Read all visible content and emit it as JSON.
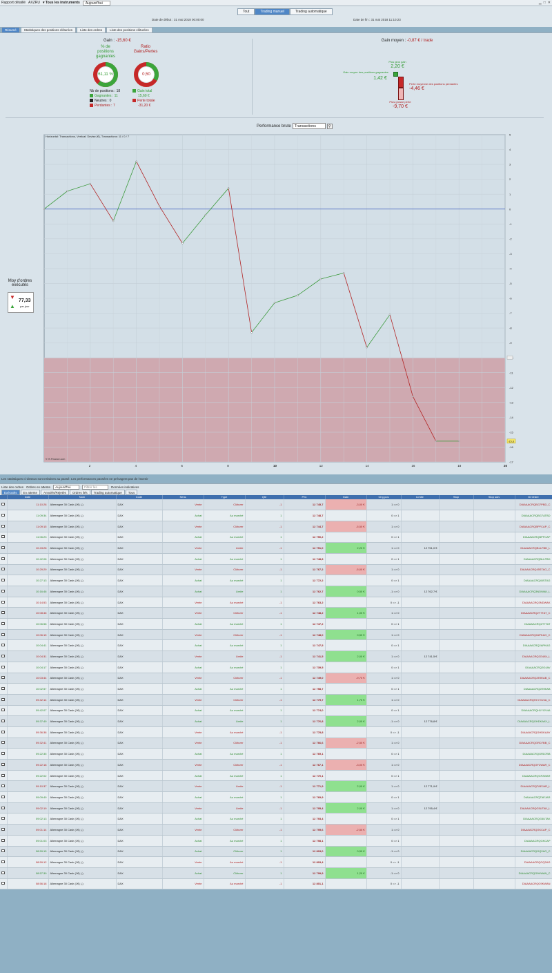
{
  "titlebar": {
    "title": "Rapport détaillé",
    "account": "AXZRU",
    "instruments": "▾ Tous les instruments",
    "period": "Aujourd'hui"
  },
  "segments": [
    "Tout",
    "Trading manuel",
    "Trading automatique"
  ],
  "active_segment": 1,
  "dates": {
    "start": "Date de début : 31 mai 2018 00:00:00",
    "end": "Date de fin : 31 mai 2018 11:10:23"
  },
  "tabs": [
    "Résumé",
    "Statistiques des positions clôturées",
    "Liste des ordres",
    "Liste des positions clôturées"
  ],
  "summary": {
    "gain_label": "Gain : ",
    "gain_value": "-15,60 €",
    "pct_title": "% de\npositions\ngagnantes",
    "pct_value": "61,11 %",
    "pct_fraction": 0.6111,
    "ratio_title": "Ratio\nGains/Pertes",
    "ratio_value": "0,50",
    "ratio_fraction": 0.333,
    "nb_positions": "Nb de positions : 18",
    "gagnantes": "Gagnantes : 11",
    "neutres": "Neutres : 0",
    "perdantes": "Perdantes : 7",
    "gain_total_label": "Gain total",
    "gain_total": "15,60 €",
    "perte_totale_label": "Perte totale",
    "perte_totale": "-31,20 €",
    "gain_moyen_label": "Gain moyen : ",
    "gain_moyen": "-0,87 € / trade",
    "plus_gros_gain_label": "Plus gros gain",
    "plus_gros_gain": "2,20 €",
    "gain_moyen_pos_label": "Gain moyen des positions gagnantes",
    "gain_moyen_pos": "1,42 €",
    "perte_moyenne_label": "Perte moyenne des positions perdantes",
    "perte_moyenne": "-4,46 €",
    "plus_grosse_perte_label": "Plus grosse perte",
    "plus_grosse_perte": "-9,70 €"
  },
  "chart_header": {
    "label": "Performance brute",
    "selector": "Transactions",
    "info": "Horizontal: Transactions, Vertical: Devise (€), Transactions: 11 / 0 / 7",
    "credit": "© IT-Finance.com"
  },
  "moy": {
    "label": "Moy d'ordres exécutés",
    "value": "77,33",
    "unit": "par jour"
  },
  "chart_data": {
    "type": "line",
    "x": [
      0,
      1,
      2,
      3,
      4,
      5,
      6,
      7,
      8,
      9,
      10,
      11,
      12,
      13,
      14,
      15,
      16,
      17,
      18
    ],
    "values": [
      0,
      1.2,
      1.7,
      -0.8,
      3.2,
      0.2,
      -2.3,
      -0.4,
      1.4,
      -8.3,
      -6.3,
      -5.8,
      -4.7,
      -4.3,
      -9.3,
      -7.1,
      -12.6,
      -15.6,
      -15.6
    ],
    "xlim": [
      0,
      20
    ],
    "ylim": [
      -17,
      5
    ],
    "xticks": [
      2,
      4,
      6,
      8,
      10,
      12,
      14,
      16,
      18,
      20
    ],
    "yticks": [
      5,
      4,
      3,
      2,
      1,
      0,
      -1,
      -2,
      -3,
      -4,
      -5,
      -6,
      -7,
      -8,
      -9,
      -10,
      -11,
      -12,
      -13,
      -14,
      -15,
      -16,
      -17
    ],
    "current_value_label": "-15,6",
    "loss_zone_from": -10,
    "up_color": "#3b9a3b",
    "down_color": "#b22222",
    "zero_line_color": "#4060c0",
    "loss_zone_color": "#cfa9b0"
  },
  "disclaimer": "Les statistiques ci-dessus sont relatives au passé. Les performances passées ne présagent pas de l'avenir",
  "orders_bar": {
    "title": "Liste des ordres",
    "mode": "Ordres en attente",
    "period": "Aujourd'hui",
    "filter_placeholder": "Filtrer les ordres",
    "data": "Données indicatives"
  },
  "order_tabs": [
    "Exécutés",
    "En attente",
    "Annulés/Rejetés",
    "Ordres liés",
    "Trading automatique",
    "Tous"
  ],
  "columns": [
    "",
    "Date",
    "Nom",
    "Code",
    "Sens",
    "Type",
    "Qté",
    "Prix",
    "Gain",
    "Chg pos",
    "Limite",
    "Stop",
    "Stop suiv",
    "ID Ordre"
  ],
  "orders": [
    [
      "11:10:28",
      "Allemagne 30 Cash (1€) (-)",
      "DAX",
      "Vente",
      "Clôturer",
      "-1",
      "12 745,7",
      "-3,00 €",
      "1 => 0",
      "",
      "",
      "",
      "DIAAAACRQBG7PBD_C"
    ],
    [
      "11:09:34",
      "Allemagne 30 Cash (1€) (-)",
      "DAX",
      "Achat",
      "Au marché",
      "1",
      "12 748,7",
      "",
      "0 => 1",
      "",
      "",
      "",
      "DIAAAACRQBG7ATBD"
    ],
    [
      "11:09:15",
      "Allemagne 30 Cash (1€) (-)",
      "DAX",
      "Vente",
      "Clôturer",
      "-1",
      "12 744,7",
      "-5,50 €",
      "1 => 0",
      "",
      "",
      "",
      "DIAAAACRQBPFCAP_C"
    ],
    [
      "11:06:23",
      "Allemagne 30 Cash (1€) (-)",
      "DAX",
      "Achat",
      "Au marché",
      "1",
      "12 750,2",
      "",
      "0 => 1",
      "",
      "",
      "",
      "DIAAAACRQBPFCAP"
    ],
    [
      "10:43:28",
      "Allemagne 30 Cash (1€) (-)",
      "DAX",
      "Vente",
      "Limite",
      "-1",
      "12 751,0",
      "2,20 €",
      "1 => 0",
      "12 751,0 €",
      "",
      "",
      "DIAAAACRQBLLFBD_L"
    ],
    [
      "10:42:08",
      "Allemagne 30 Cash (1€) (-)",
      "DAX",
      "Achat",
      "Au marché",
      "1",
      "12 748,8",
      "",
      "0 => 1",
      "",
      "",
      "",
      "DIAAAACRQBLLFBD"
    ],
    [
      "10:29:29",
      "Allemagne 30 Cash (1€) (-)",
      "DAX",
      "Vente",
      "Clôturer",
      "-1",
      "12 767,2",
      "-5,00 €",
      "1 => 0",
      "",
      "",
      "",
      "DIAAAACRQ45STAG_C"
    ],
    [
      "10:27:13",
      "Allemagne 30 Cash (1€) (-)",
      "DAX",
      "Achat",
      "Au marché",
      "1",
      "12 772,2",
      "",
      "0 => 1",
      "",
      "",
      "",
      "DIAAAACRQ45STAG"
    ],
    [
      "10:16:46",
      "Allemagne 30 Cash (1€) (-)",
      "DAX",
      "Achat",
      "Limite",
      "1",
      "12 762,7",
      "0,50 €",
      "-1 => 0",
      "12 762,7 €",
      "",
      "",
      "DIAAAACRQ3NDWAK_L"
    ],
    [
      "10:14:53",
      "Allemagne 30 Cash (1€) (-)",
      "DAX",
      "Vente",
      "Au marché",
      "-1",
      "12 763,2",
      "",
      "0 => -1",
      "",
      "",
      "",
      "DIAAAACRQ3NDWAK"
    ],
    [
      "10:08:46",
      "Allemagne 30 Cash (1€) (-)",
      "DAX",
      "Vente",
      "Clôturer",
      "-1",
      "12 748,2",
      "1,00 €",
      "1 => 0",
      "",
      "",
      "",
      "DIAAAACRQ2T7TAT_C"
    ],
    [
      "10:06:58",
      "Allemagne 30 Cash (1€) (-)",
      "DAX",
      "Achat",
      "Au marché",
      "1",
      "12 747,2",
      "",
      "0 => 1",
      "",
      "",
      "",
      "DIAAAACRQ2T7TAT"
    ],
    [
      "10:06:15",
      "Allemagne 30 Cash (1€) (-)",
      "DAX",
      "Vente",
      "Clôturer",
      "-1",
      "12 748,0",
      "0,50 €",
      "1 => 0",
      "",
      "",
      "",
      "DIAAAACRQ2APKAG_C"
    ],
    [
      "10:04:41",
      "Allemagne 30 Cash (1€) (-)",
      "DAX",
      "Achat",
      "Au marché",
      "1",
      "12 747,5",
      "",
      "0 => 1",
      "",
      "",
      "",
      "DIAAAACRQ2APKAG"
    ],
    [
      "10:04:31",
      "Allemagne 30 Cash (1€) (-)",
      "DAX",
      "Vente",
      "Limite",
      "-1",
      "12 741,5",
      "2,00 €",
      "1 => 0",
      "12 741,5 €",
      "",
      "",
      "DIAAAACRQ2G4AV_L"
    ],
    [
      "10:04:17",
      "Allemagne 30 Cash (1€) (-)",
      "DAX",
      "Achat",
      "Au marché",
      "1",
      "12 739,5",
      "",
      "0 => 1",
      "",
      "",
      "",
      "DIAAAACRQ2G4AV"
    ],
    [
      "10:03:44",
      "Allemagne 30 Cash (1€) (-)",
      "DAX",
      "Vente",
      "Clôturer",
      "-1",
      "12 749,0",
      "-9,70 €",
      "1 => 0",
      "",
      "",
      "",
      "DIAAAACRQ2E9EAB_C"
    ],
    [
      "10:02:57",
      "Allemagne 30 Cash (1€) (-)",
      "DAX",
      "Achat",
      "Au marché",
      "1",
      "12 758,7",
      "",
      "0 => 1",
      "",
      "",
      "",
      "DIAAAACRQ2E9EAB"
    ],
    [
      "09:42:14",
      "Allemagne 30 Cash (1€) (-)",
      "DAX",
      "Vente",
      "Clôturer",
      "-1",
      "12 775,7",
      "1,70 €",
      "1 => 0",
      "",
      "",
      "",
      "DIAAAACRQH1YGV4A_C"
    ],
    [
      "09:42:07",
      "Allemagne 30 Cash (1€) (-)",
      "DAX",
      "Achat",
      "Au marché",
      "1",
      "12 774,0",
      "",
      "0 => 1",
      "",
      "",
      "",
      "DIAAAACRQH1YGV4A"
    ],
    [
      "09:37:49",
      "Allemagne 30 Cash (1€) (-)",
      "DAX",
      "Achat",
      "Limite",
      "1",
      "12 776,8",
      "2,00 €",
      "-1 => 0",
      "12 776,8 €",
      "",
      "",
      "DIAAAACRQGHDKAAY_L"
    ],
    [
      "09:36:38",
      "Allemagne 30 Cash (1€) (-)",
      "DAX",
      "Vente",
      "Au marché",
      "-1",
      "12 778,8",
      "",
      "0 => -1",
      "",
      "",
      "",
      "DIAAAACRQGHDKAAY"
    ],
    [
      "09:32:41",
      "Allemagne 30 Cash (1€) (-)",
      "DAX",
      "Vente",
      "Clôturer",
      "-1",
      "12 766,6",
      "-2,50 €",
      "1 => 0",
      "",
      "",
      "",
      "DIAAAACRQGRD7BB_C"
    ],
    [
      "09:22:35",
      "Allemagne 30 Cash (1€) (-)",
      "DAX",
      "Achat",
      "Au marché",
      "1",
      "12 769,1",
      "",
      "0 => 1",
      "",
      "",
      "",
      "DIAAAACRQGRD7BB"
    ],
    [
      "09:22:18",
      "Allemagne 30 Cash (1€) (-)",
      "DAX",
      "Vente",
      "Clôturer",
      "-1",
      "12 767,1",
      "-3,00 €",
      "1 => 0",
      "",
      "",
      "",
      "DIAAAACRQGF2WAR_C"
    ],
    [
      "09:22:02",
      "Allemagne 30 Cash (1€) (-)",
      "DAX",
      "Achat",
      "Au marché",
      "1",
      "12 770,1",
      "",
      "0 => 1",
      "",
      "",
      "",
      "DIAAAACRQGF2WAR"
    ],
    [
      "09:10:37",
      "Allemagne 30 Cash (1€) (-)",
      "DAX",
      "Vente",
      "Limite",
      "-1",
      "12 771,9",
      "2,00 €",
      "1 => 0",
      "12 771,9 €",
      "",
      "",
      "DIAAAACRQTAEJAR_L"
    ],
    [
      "09:09:49",
      "Allemagne 30 Cash (1€) (-)",
      "DAX",
      "Achat",
      "Au marché",
      "1",
      "12 769,9",
      "",
      "0 => 1",
      "",
      "",
      "",
      "DIAAAACRQTAEJAR"
    ],
    [
      "09:02:19",
      "Allemagne 30 Cash (1€) (-)",
      "DAX",
      "Vente",
      "Limite",
      "-1",
      "12 795,4",
      "2,00 €",
      "1 => 0",
      "12 795,4 €",
      "",
      "",
      "DIAAAACRQG5UTAK_L"
    ],
    [
      "09:02:13",
      "Allemagne 30 Cash (1€) (-)",
      "DAX",
      "Achat",
      "Au marché",
      "1",
      "12 793,4",
      "",
      "0 => 1",
      "",
      "",
      "",
      "DIAAAACRQG5UTAK"
    ],
    [
      "09:01:14",
      "Allemagne 30 Cash (1€) (-)",
      "DAX",
      "Vente",
      "Clôturer",
      "-1",
      "12 795,6",
      "-2,50 €",
      "1 => 0",
      "",
      "",
      "",
      "DIAAAACRQGKCAP_C"
    ],
    [
      "09:01:03",
      "Allemagne 30 Cash (1€) (-)",
      "DAX",
      "Achat",
      "Au marché",
      "1",
      "12 798,1",
      "",
      "0 => 1",
      "",
      "",
      "",
      "DIAAAACRQGKCAP"
    ],
    [
      "08:59:15",
      "Allemagne 30 Cash (1€) (-)",
      "DAX",
      "Achat",
      "Clôturer",
      "1",
      "12 803,0",
      "0,50 €",
      "-1 => 0",
      "",
      "",
      "",
      "DIAAAACRQGQ2AG_C"
    ],
    [
      "08:59:12",
      "Allemagne 30 Cash (1€) (-)",
      "DAX",
      "Vente",
      "Au marché",
      "-1",
      "12 803,4",
      "",
      "0 => -1",
      "",
      "",
      "",
      "DIAAAACRQGQ2AG"
    ],
    [
      "08:57:39",
      "Allemagne 30 Cash (1€) (-)",
      "DAX",
      "Achat",
      "Clôturer",
      "1",
      "12 799,9",
      "1,20 €",
      "-1 => 0",
      "",
      "",
      "",
      "DIAAAACRQG9KWAN_C"
    ],
    [
      "08:56:18",
      "Allemagne 30 Cash (1€) (-)",
      "DAX",
      "Vente",
      "Au marché",
      "-1",
      "12 801,1",
      "",
      "0 => -1",
      "",
      "",
      "",
      "DIAAAACRQG9KWAN"
    ]
  ]
}
